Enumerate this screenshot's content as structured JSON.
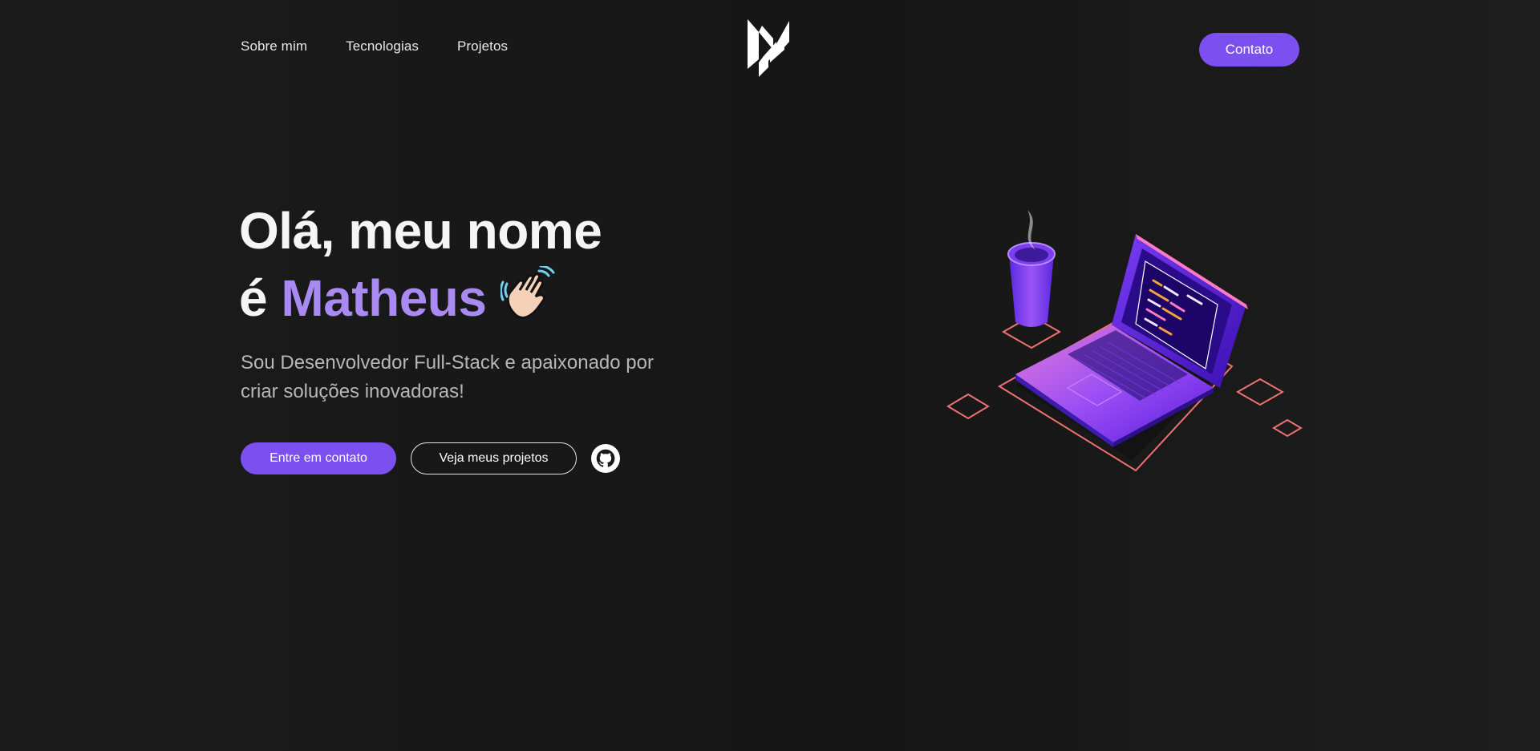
{
  "nav": {
    "links": [
      "Sobre mim",
      "Tecnologias",
      "Projetos"
    ],
    "contact_label": "Contato"
  },
  "hero": {
    "title_line1": "Olá, meu nome",
    "title_prefix": "é ",
    "title_name": "Matheus",
    "subtitle": "Sou Desenvolvedor Full-Stack e apaixonado por criar soluções inovadoras!",
    "primary_cta": "Entre em contato",
    "secondary_cta": "Veja meus projetos",
    "wave_emoji": "waving-hand-icon",
    "github_icon": "github-icon"
  },
  "colors": {
    "background": "#1a1a1a",
    "accent": "#7c4ff0",
    "name_highlight": "#a98af2",
    "subtitle": "#b7b7b7",
    "illustration_outline": "#f06d6d"
  }
}
